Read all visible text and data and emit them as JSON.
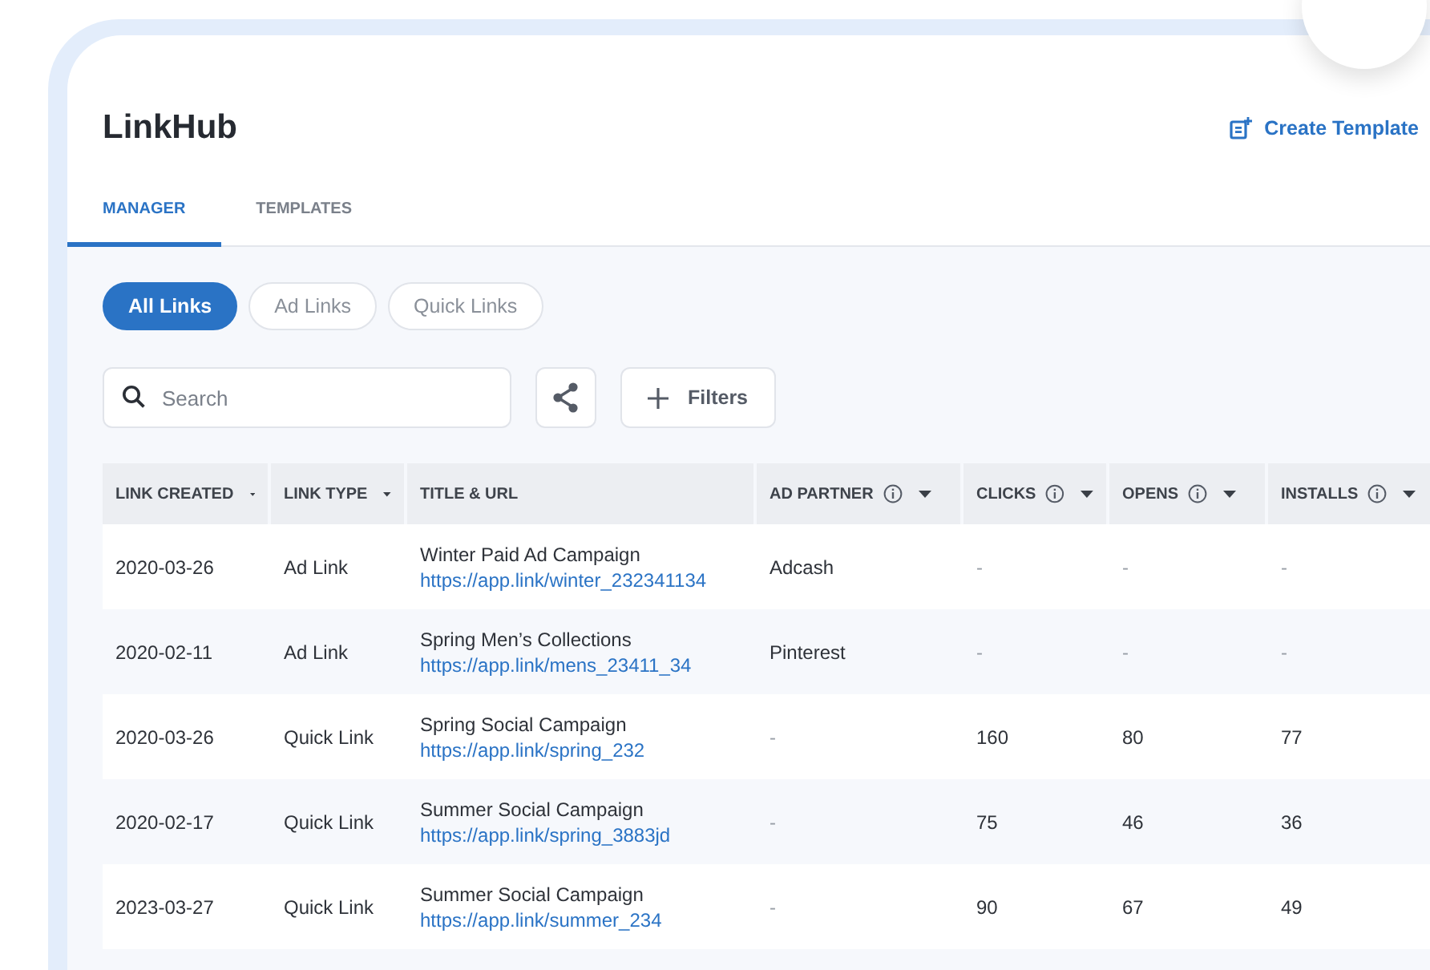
{
  "app": {
    "title": "LinkHub",
    "action": "Create Template"
  },
  "tabs": [
    {
      "label": "MANAGER",
      "selected": true
    },
    {
      "label": "TEMPLATES",
      "selected": false
    }
  ],
  "filters": [
    {
      "label": "All Links",
      "selected": true
    },
    {
      "label": "Ad Links",
      "selected": false
    },
    {
      "label": "Quick Links",
      "selected": false
    }
  ],
  "search": {
    "placeholder": "Search"
  },
  "filters_button": "Filters",
  "table": {
    "columns": [
      {
        "label": "LINK CREATED",
        "info": false,
        "sortable": true
      },
      {
        "label": "LINK TYPE",
        "info": false,
        "sortable": true
      },
      {
        "label": "TITLE & URL",
        "info": false,
        "sortable": false
      },
      {
        "label": "AD PARTNER",
        "info": true,
        "sortable": true
      },
      {
        "label": "CLICKS",
        "info": true,
        "sortable": true
      },
      {
        "label": "OPENS",
        "info": true,
        "sortable": true
      },
      {
        "label": "INSTALLS",
        "info": true,
        "sortable": true
      }
    ],
    "rows": [
      {
        "created": "2020-03-26",
        "type": "Ad Link",
        "title": "Winter Paid Ad Campaign",
        "url": "https://app.link/winter_232341134",
        "partner": "Adcash",
        "clicks": "-",
        "opens": "-",
        "installs": "-"
      },
      {
        "created": "2020-02-11",
        "type": "Ad Link",
        "title": "Spring Men’s Collections",
        "url": "https://app.link/mens_23411_34",
        "partner": "Pinterest",
        "clicks": "-",
        "opens": "-",
        "installs": "-"
      },
      {
        "created": "2020-03-26",
        "type": "Quick Link",
        "title": "Spring Social Campaign",
        "url": "https://app.link/spring_232",
        "partner": "-",
        "clicks": "160",
        "opens": "80",
        "installs": "77"
      },
      {
        "created": "2020-02-17",
        "type": "Quick Link",
        "title": "Summer Social Campaign",
        "url": "https://app.link/spring_3883jd",
        "partner": "-",
        "clicks": "75",
        "opens": "46",
        "installs": "36"
      },
      {
        "created": "2023-03-27",
        "type": "Quick Link",
        "title": "Summer Social Campaign",
        "url": "https://app.link/summer_234",
        "partner": "-",
        "clicks": "90",
        "opens": "67",
        "installs": "49"
      }
    ]
  }
}
